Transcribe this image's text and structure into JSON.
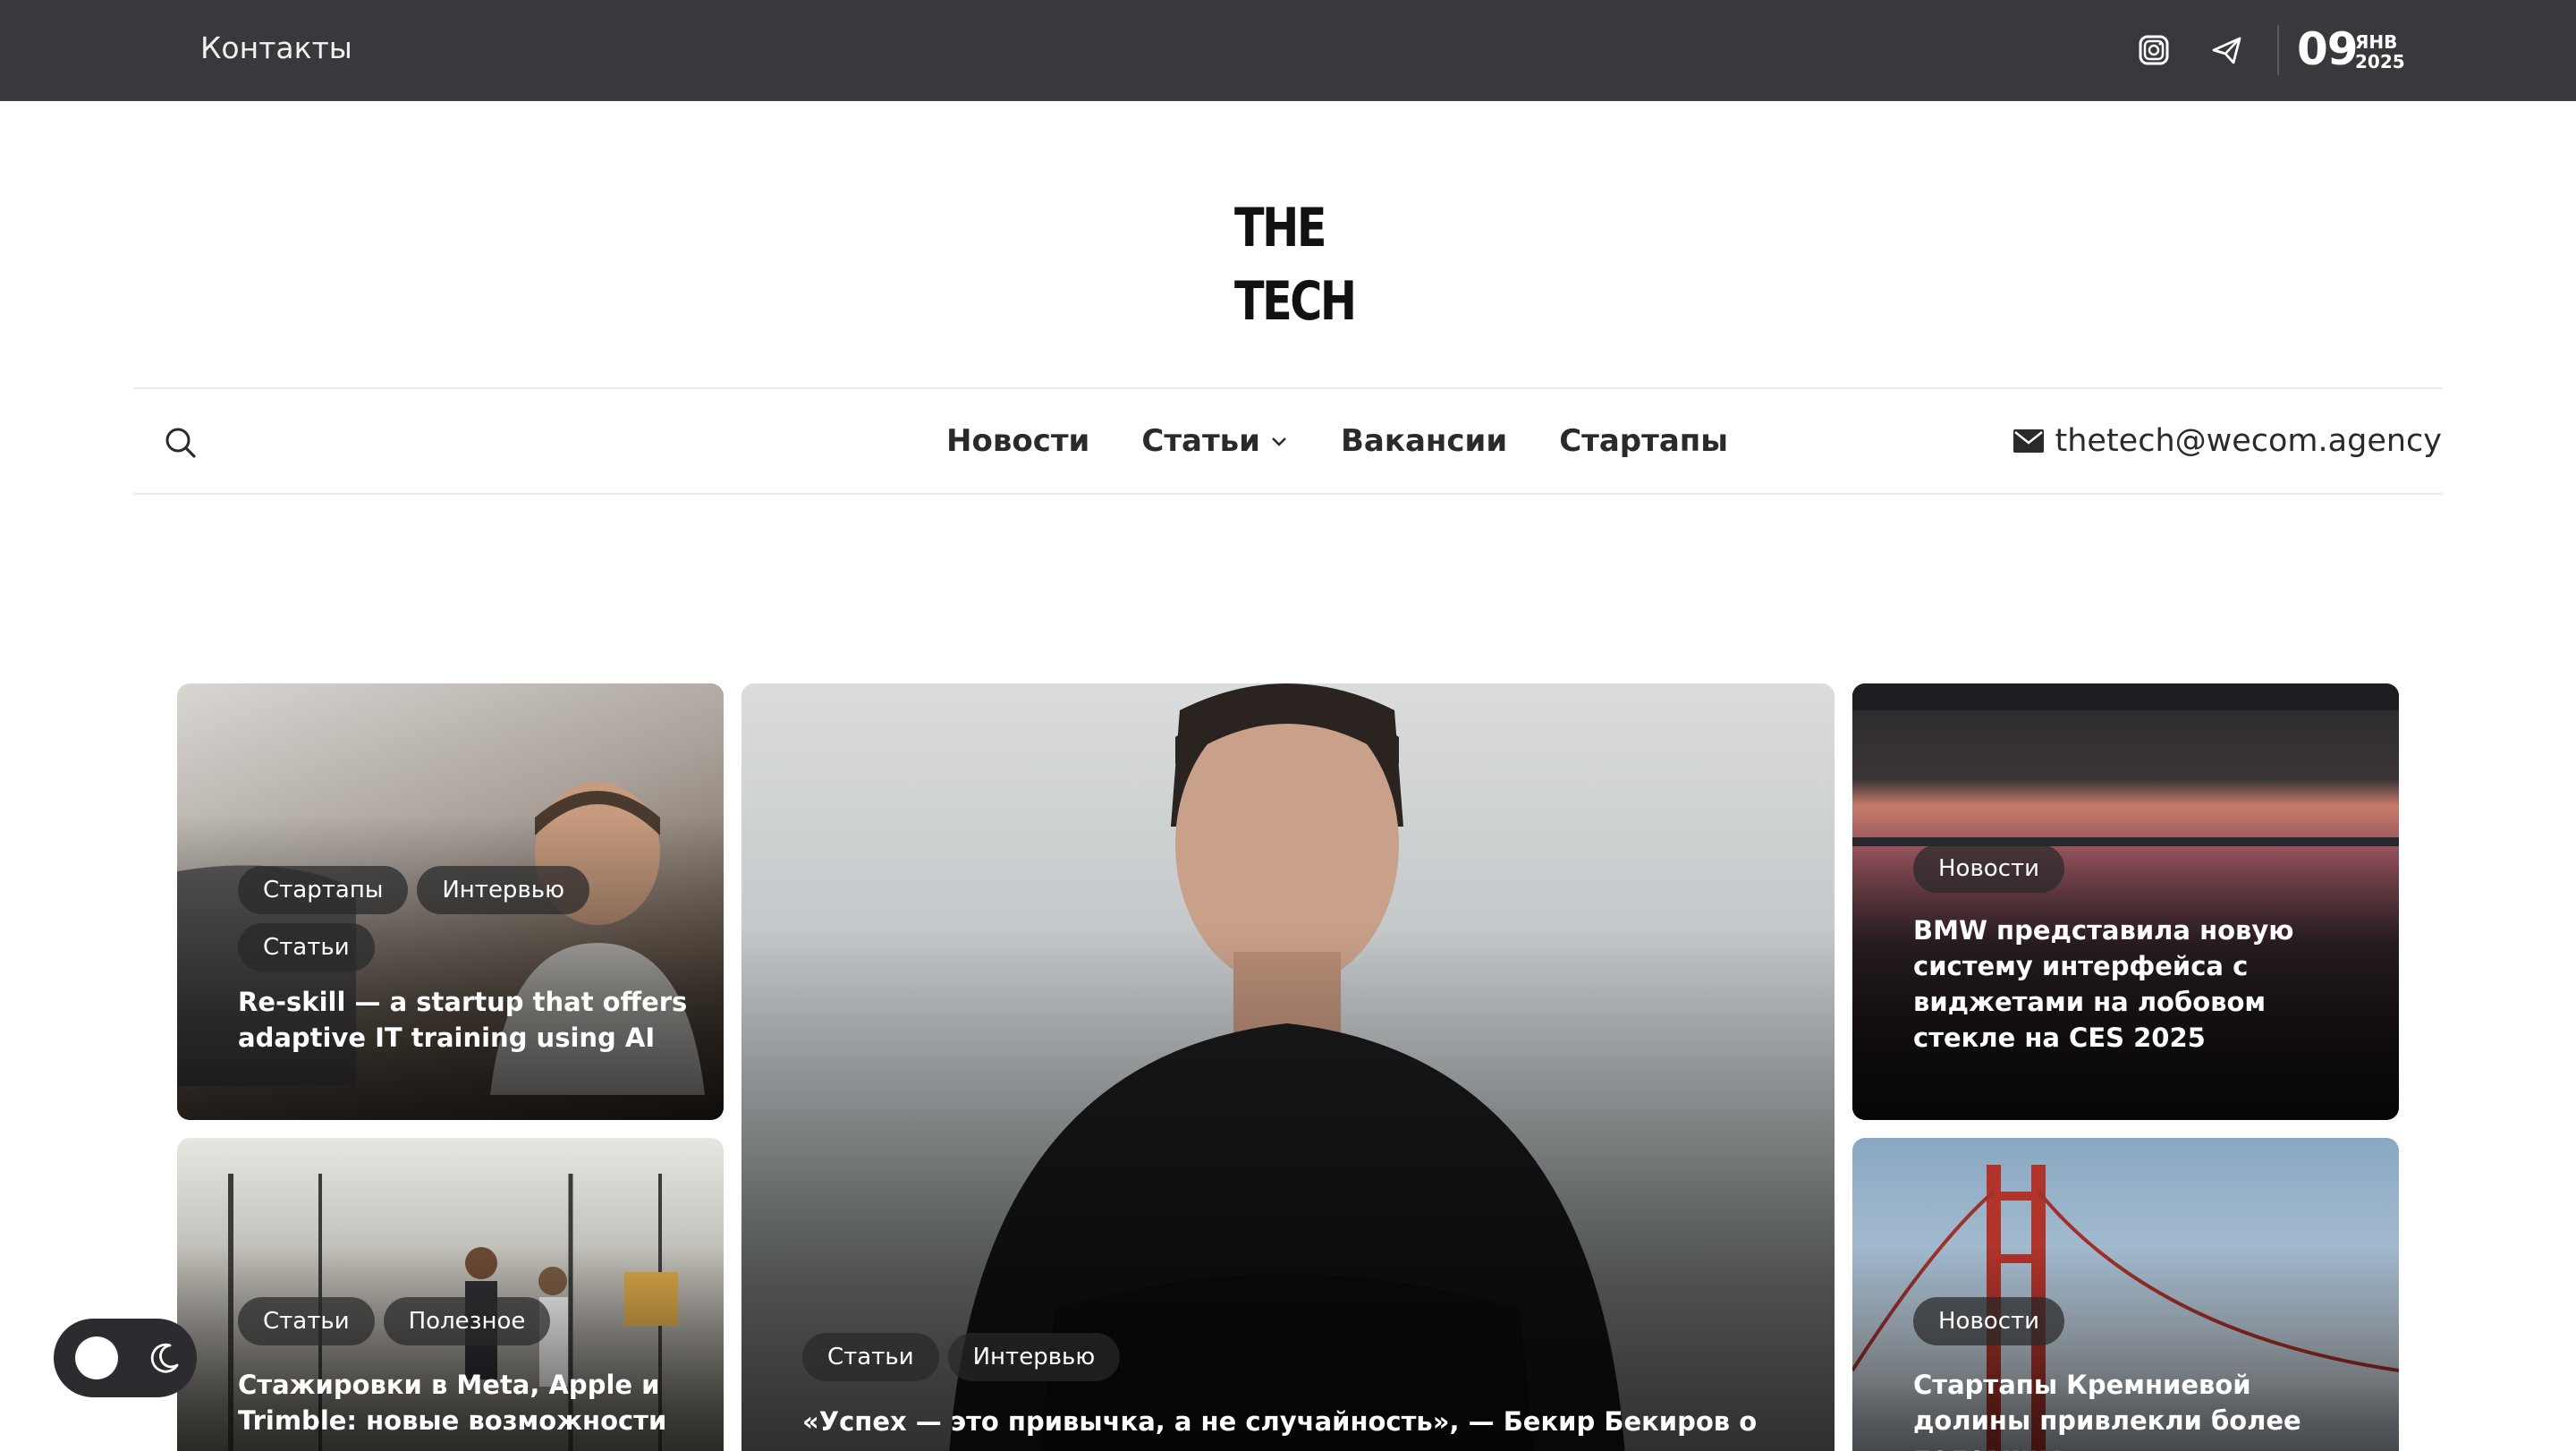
{
  "topbar": {
    "contacts_label": "Контакты",
    "social_icons": [
      "instagram-icon",
      "telegram-icon"
    ],
    "date_day": "09",
    "date_month": "ЯНВ",
    "date_year": "2025"
  },
  "logo": {
    "line1": "THE",
    "line2": "TECH"
  },
  "nav": {
    "items": [
      {
        "label": "Новости"
      },
      {
        "label": "Статьи",
        "has_dropdown": true
      },
      {
        "label": "Вакансии"
      },
      {
        "label": "Стартапы"
      }
    ],
    "email": "thetech@wecom.agency"
  },
  "cards": [
    {
      "tags": [
        "Стартапы",
        "Интервью",
        "Статьи"
      ],
      "title": "Re-skill — a startup that offers adaptive IT training using AI"
    },
    {
      "tags": [
        "Статьи",
        "Интервью"
      ],
      "title": "«Успех — это привычка, а не случайность», — Бекир Бекиров о своем"
    },
    {
      "tags": [
        "Новости"
      ],
      "title": "BMW представила новую систему интерфейса с виджетами на лобовом стекле на CES 2025"
    },
    {
      "tags": [
        "Статьи",
        "Полезное"
      ],
      "title": "Стажировки в Meta, Apple и Trimble: новые возможности"
    },
    {
      "tags": [
        "Новости"
      ],
      "title": "Стартапы Кремниевой долины привлекли более половины"
    }
  ],
  "theme_toggle": {
    "icons": [
      "sun-knob",
      "moon-icon"
    ]
  }
}
